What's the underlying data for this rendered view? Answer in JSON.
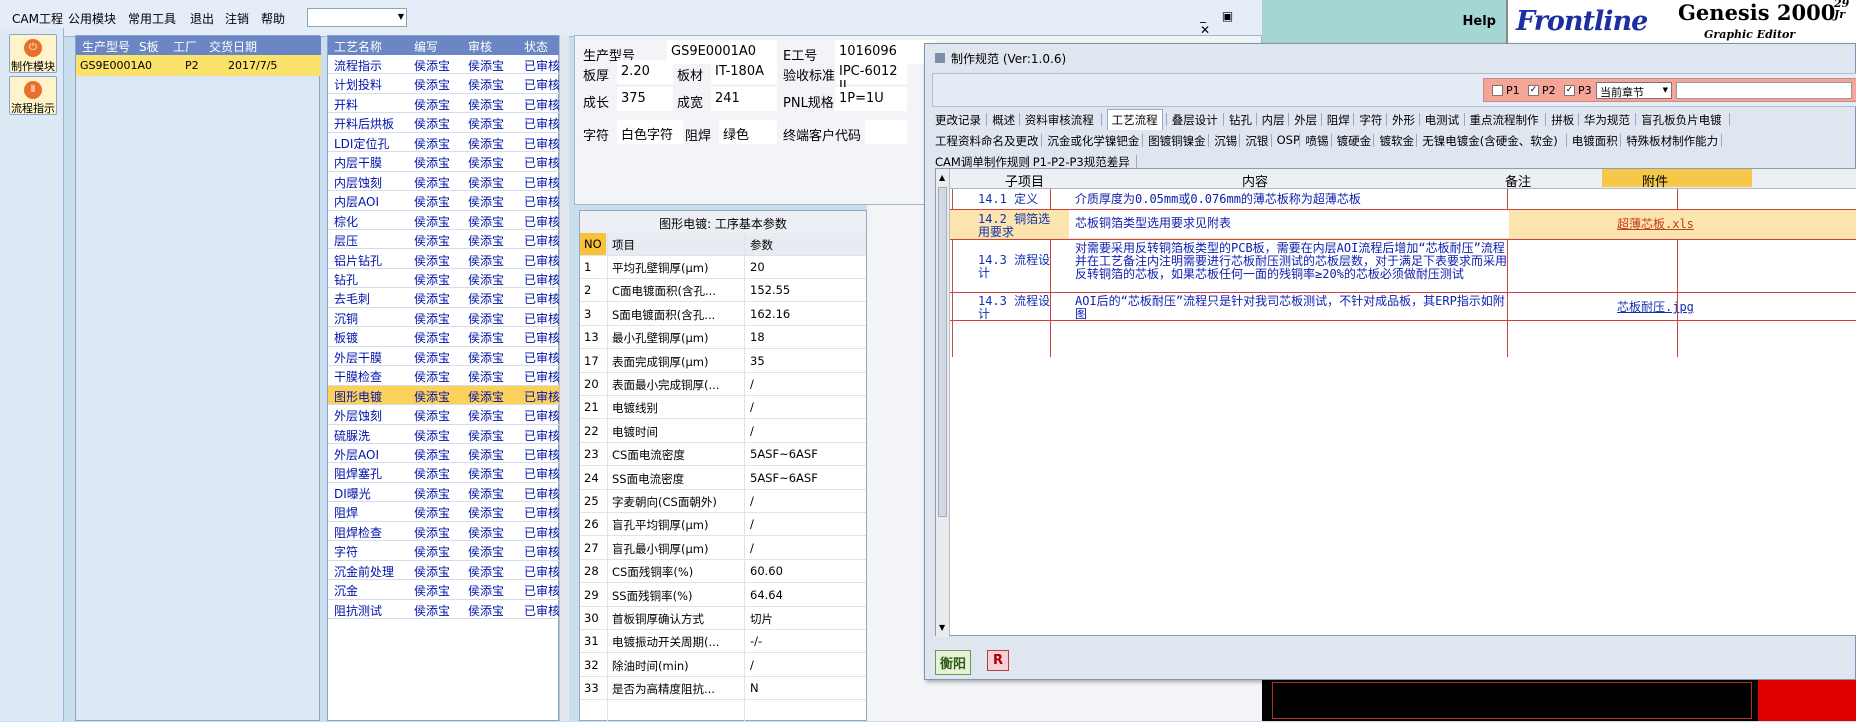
{
  "menu": {
    "items": [
      "CAM工程",
      "公用模块",
      "常用工具",
      "退出",
      "注销",
      "帮助"
    ],
    "combo_value": "",
    "window_controls": "_ ▣ ✕"
  },
  "right_app": {
    "help": "Help",
    "logo": "Frontline",
    "product": "Genesis 2000",
    "subtitle": "Graphic Editor",
    "date_fragment": "29 Jr"
  },
  "sidebar": {
    "buttons": [
      {
        "label": "制作模块",
        "icon": "module-icon"
      },
      {
        "label": "流程指示",
        "icon": "flow-icon"
      }
    ]
  },
  "grid1": {
    "headers": [
      "生产型号",
      "S板",
      "工厂",
      "交货日期"
    ],
    "row": {
      "model": "GS9E0001A0",
      "sboard": "",
      "factory": "P2",
      "date": "2017/7/5"
    }
  },
  "grid2": {
    "headers": [
      "工艺名称",
      "编写",
      "审核",
      "状态"
    ],
    "rows": [
      {
        "name": "流程指示",
        "author": "侯添宝",
        "reviewer": "侯添宝",
        "status": "已审核"
      },
      {
        "name": "计划投料",
        "author": "侯添宝",
        "reviewer": "侯添宝",
        "status": "已审核"
      },
      {
        "name": "开料",
        "author": "侯添宝",
        "reviewer": "侯添宝",
        "status": "已审核"
      },
      {
        "name": "开料后烘板",
        "author": "侯添宝",
        "reviewer": "侯添宝",
        "status": "已审核"
      },
      {
        "name": "LDI定位孔",
        "author": "侯添宝",
        "reviewer": "侯添宝",
        "status": "已审核"
      },
      {
        "name": "内层干膜",
        "author": "侯添宝",
        "reviewer": "侯添宝",
        "status": "已审核"
      },
      {
        "name": "内层蚀刻",
        "author": "侯添宝",
        "reviewer": "侯添宝",
        "status": "已审核"
      },
      {
        "name": "内层AOI",
        "author": "侯添宝",
        "reviewer": "侯添宝",
        "status": "已审核"
      },
      {
        "name": "棕化",
        "author": "侯添宝",
        "reviewer": "侯添宝",
        "status": "已审核"
      },
      {
        "name": "层压",
        "author": "侯添宝",
        "reviewer": "侯添宝",
        "status": "已审核"
      },
      {
        "name": "铝片钻孔",
        "author": "侯添宝",
        "reviewer": "侯添宝",
        "status": "已审核"
      },
      {
        "name": "钻孔",
        "author": "侯添宝",
        "reviewer": "侯添宝",
        "status": "已审核"
      },
      {
        "name": "去毛刺",
        "author": "侯添宝",
        "reviewer": "侯添宝",
        "status": "已审核"
      },
      {
        "name": "沉铜",
        "author": "侯添宝",
        "reviewer": "侯添宝",
        "status": "已审核"
      },
      {
        "name": "板镀",
        "author": "侯添宝",
        "reviewer": "侯添宝",
        "status": "已审核"
      },
      {
        "name": "外层干膜",
        "author": "侯添宝",
        "reviewer": "侯添宝",
        "status": "已审核"
      },
      {
        "name": "干膜检查",
        "author": "侯添宝",
        "reviewer": "侯添宝",
        "status": "已审核"
      },
      {
        "name": "图形电镀",
        "author": "侯添宝",
        "reviewer": "侯添宝",
        "status": "已审核"
      },
      {
        "name": "外层蚀刻",
        "author": "侯添宝",
        "reviewer": "侯添宝",
        "status": "已审核"
      },
      {
        "name": "硫脲洗",
        "author": "侯添宝",
        "reviewer": "侯添宝",
        "status": "已审核"
      },
      {
        "name": "外层AOI",
        "author": "侯添宝",
        "reviewer": "侯添宝",
        "status": "已审核"
      },
      {
        "name": "阻焊塞孔",
        "author": "侯添宝",
        "reviewer": "侯添宝",
        "status": "已审核"
      },
      {
        "name": "DI曝光",
        "author": "侯添宝",
        "reviewer": "侯添宝",
        "status": "已审核"
      },
      {
        "name": "阻焊",
        "author": "侯添宝",
        "reviewer": "侯添宝",
        "status": "已审核"
      },
      {
        "name": "阻焊检查",
        "author": "侯添宝",
        "reviewer": "侯添宝",
        "status": "已审核"
      },
      {
        "name": "字符",
        "author": "侯添宝",
        "reviewer": "侯添宝",
        "status": "已审核"
      },
      {
        "name": "沉金前处理",
        "author": "侯添宝",
        "reviewer": "侯添宝",
        "status": "已审核"
      },
      {
        "name": "沉金",
        "author": "侯添宝",
        "reviewer": "侯添宝",
        "status": "已审核"
      },
      {
        "name": "阻抗测试",
        "author": "侯添宝",
        "reviewer": "侯添宝",
        "status": "已审核"
      }
    ],
    "selected_index": 17
  },
  "info": {
    "prod_model_label": "生产型号",
    "prod_model": "GS9E0001A0",
    "eno_label": "E工号",
    "eno": "1016096",
    "thick_label": "板厚",
    "thick": "2.20",
    "material_label": "板材",
    "material": "IT-180A",
    "accept_label": "验收标准",
    "accept": "IPC-6012 II",
    "len_label": "成长",
    "len": "375",
    "width_label": "成宽",
    "width": "241",
    "pnl_label": "PNL规格",
    "pnl": "1P=1U",
    "char_label": "字符",
    "char": "白色字符",
    "mask_label": "阻焊",
    "mask": "绿色",
    "cust_label": "终端客户代码",
    "cust": ""
  },
  "params": {
    "title": "图形电镀: 工序基本参数",
    "headers": [
      "NO",
      "项目",
      "参数"
    ],
    "rows": [
      {
        "no": "1",
        "item": "平均孔壁铜厚(μm)",
        "value": "20"
      },
      {
        "no": "2",
        "item": "C面电镀面积(含孔...",
        "value": "152.55"
      },
      {
        "no": "3",
        "item": "S面电镀面积(含孔...",
        "value": "162.16"
      },
      {
        "no": "13",
        "item": "最小孔壁铜厚(μm)",
        "value": "18"
      },
      {
        "no": "17",
        "item": "表面完成铜厚(μm)",
        "value": "35"
      },
      {
        "no": "20",
        "item": "表面最小完成铜厚(...",
        "value": "/"
      },
      {
        "no": "21",
        "item": "电镀线别",
        "value": "/"
      },
      {
        "no": "22",
        "item": "电镀时间",
        "value": "/"
      },
      {
        "no": "23",
        "item": "CS面电流密度",
        "value": "5ASF~6ASF"
      },
      {
        "no": "24",
        "item": "SS面电流密度",
        "value": "5ASF~6ASF"
      },
      {
        "no": "25",
        "item": "字麦朝向(CS面朝外)",
        "value": "/"
      },
      {
        "no": "26",
        "item": "盲孔平均铜厚(μm)",
        "value": "/"
      },
      {
        "no": "27",
        "item": "盲孔最小铜厚(μm)",
        "value": "/"
      },
      {
        "no": "28",
        "item": "CS面残铜率(%)",
        "value": "60.60"
      },
      {
        "no": "29",
        "item": "SS面残铜率(%)",
        "value": "64.64"
      },
      {
        "no": "30",
        "item": "首板铜厚确认方式",
        "value": "切片"
      },
      {
        "no": "31",
        "item": "电镀振动开关周期(...",
        "value": "-/-"
      },
      {
        "no": "32",
        "item": "除油时间(min)",
        "value": "/"
      },
      {
        "no": "33",
        "item": "是否为高精度阻抗...",
        "value": "N"
      }
    ]
  },
  "dialog": {
    "title": "制作规范 (Ver:1.0.6)",
    "p1": "P1",
    "p2": "P2",
    "p3": "P3",
    "chapter": "当前章节",
    "tabs_row1": [
      "更改记录",
      "概述",
      "资料审核流程",
      "工艺流程",
      "叠层设计",
      "钻孔",
      "内层",
      "外层",
      "阻焊",
      "字符",
      "外形",
      "电测试",
      "重点流程制作",
      "拼板",
      "华为规范",
      "盲孔板负片电镀"
    ],
    "tabs_row2": [
      "工程资料命名及更改",
      "沉金或化学镍钯金",
      "图镀铜镍金",
      "沉锡",
      "沉银",
      "OSP",
      "喷锡",
      "镀硬金",
      "镀软金",
      "无镍电镀金(含硬金、软金)",
      "电镀面积",
      "特殊板材制作能力"
    ],
    "tabs_row3": [
      "CAM调单制作规则",
      "P1-P2-P3规范差异"
    ],
    "active_tab": "工艺流程",
    "table_headers": [
      "子项目",
      "内容",
      "备注",
      "附件"
    ],
    "rows": [
      {
        "sub": "14.1 定义",
        "content": "介质厚度为0.05mm或0.076mm的薄芯板称为超薄芯板",
        "note": "",
        "attach": ""
      },
      {
        "sub": "14.2 铜箔选用要求",
        "content": "芯板铜箔类型选用要求见附表",
        "note": "",
        "attach": "超薄芯板.xls"
      },
      {
        "sub": "14.3 流程设计",
        "content": "对需要采用反转铜箔板类型的PCB板，需要在内层AOI流程后增加“芯板耐压”流程并在工艺备注内注明需要进行芯板耐压测试的芯板层数，对于满足下表要求而采用反转铜箔的芯板，如果芯板任何一面的残铜率≥20%的芯板必须做耐压测试",
        "note": "",
        "attach": ""
      },
      {
        "sub": "14.3 流程设计",
        "content": "AOI后的“芯板耐压”流程只是针对我司芯板测试，不针对成品板，其ERP指示如附图",
        "note": "",
        "attach": "芯板耐压.jpg"
      }
    ],
    "status_left": "衡阳",
    "status_right": "R"
  }
}
